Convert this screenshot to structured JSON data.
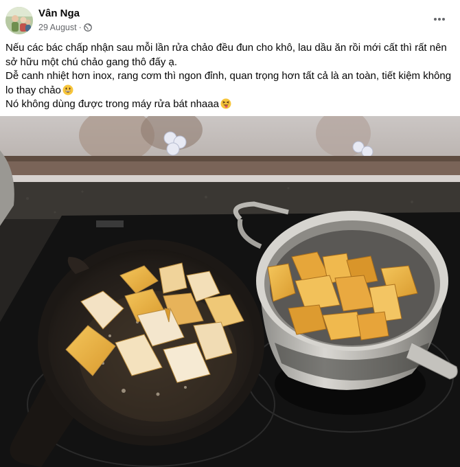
{
  "post": {
    "author": "Vân Nga",
    "date": "29 August",
    "separator": "·",
    "audience_icon": "globe-icon",
    "more_icon": "more-options-icon",
    "lines": [
      "Nếu các bác chấp nhận sau mỗi lần rửa chảo đều đun cho khô, lau dầu ăn rồi mới cất thì rất nên sở hữu một chú chảo gang thô đấy ạ.",
      "Dễ canh nhiệt hơn inox, rang cơm thì ngon đỉnh, quan trọng hơn tất cả là an toàn, tiết kiệm không lo thay chảo",
      "Nó không dùng được trong máy rửa bát nhaaa"
    ],
    "emojis": [
      "grinning-face-emoji",
      "squinting-tongue-face-emoji"
    ]
  },
  "colors": {
    "text": "#050505",
    "secondary_text": "#65676b",
    "background": "#ffffff",
    "emoji_yellow": "#f7c53b"
  },
  "photo": {
    "subject": "cast iron skillet with fried tofu cubes and steel pot of fried tofu on induction stove"
  }
}
